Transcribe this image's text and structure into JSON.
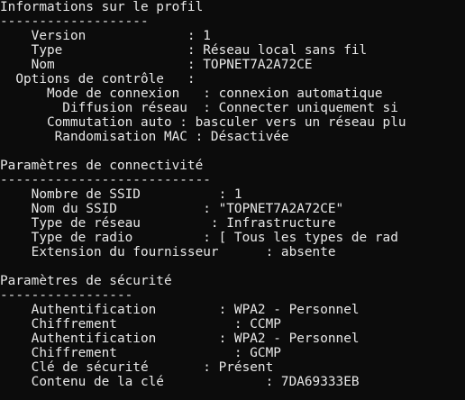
{
  "terminal": {
    "colors": {
      "background": "#0c0c0c",
      "foreground": "#e8e8e8"
    },
    "lines": [
      "Informations sur le profil",
      "-------------------",
      "    Version             : 1",
      "    Type                : Réseau local sans fil",
      "    Nom                 : TOPNET7A2A72CE",
      "  Options de contrôle   :",
      "      Mode de connexion   : connexion automatique",
      "        Diffusion réseau  : Connecter uniquement si",
      "      Commutation auto : basculer vers un réseau plu",
      "       Randomisation MAC : Désactivée",
      "",
      "Paramètres de connectivité",
      "---------------------------",
      "    Nombre de SSID          : 1",
      "    Nom du SSID           : \"TOPNET7A2A72CE\"",
      "    Type de réseau         : Infrastructure",
      "    Type de radio         : [ Tous les types de rad",
      "    Extension du fournisseur      : absente",
      "",
      "Paramètres de sécurité",
      "-----------------",
      "    Authentification        : WPA2 - Personnel",
      "    Chiffrement               : CCMP",
      "    Authentification        : WPA2 - Personnel",
      "    Chiffrement               : GCMP",
      "    Clé de sécurité       : Présent",
      "    Contenu de la clé             : 7DA69333EB"
    ]
  }
}
